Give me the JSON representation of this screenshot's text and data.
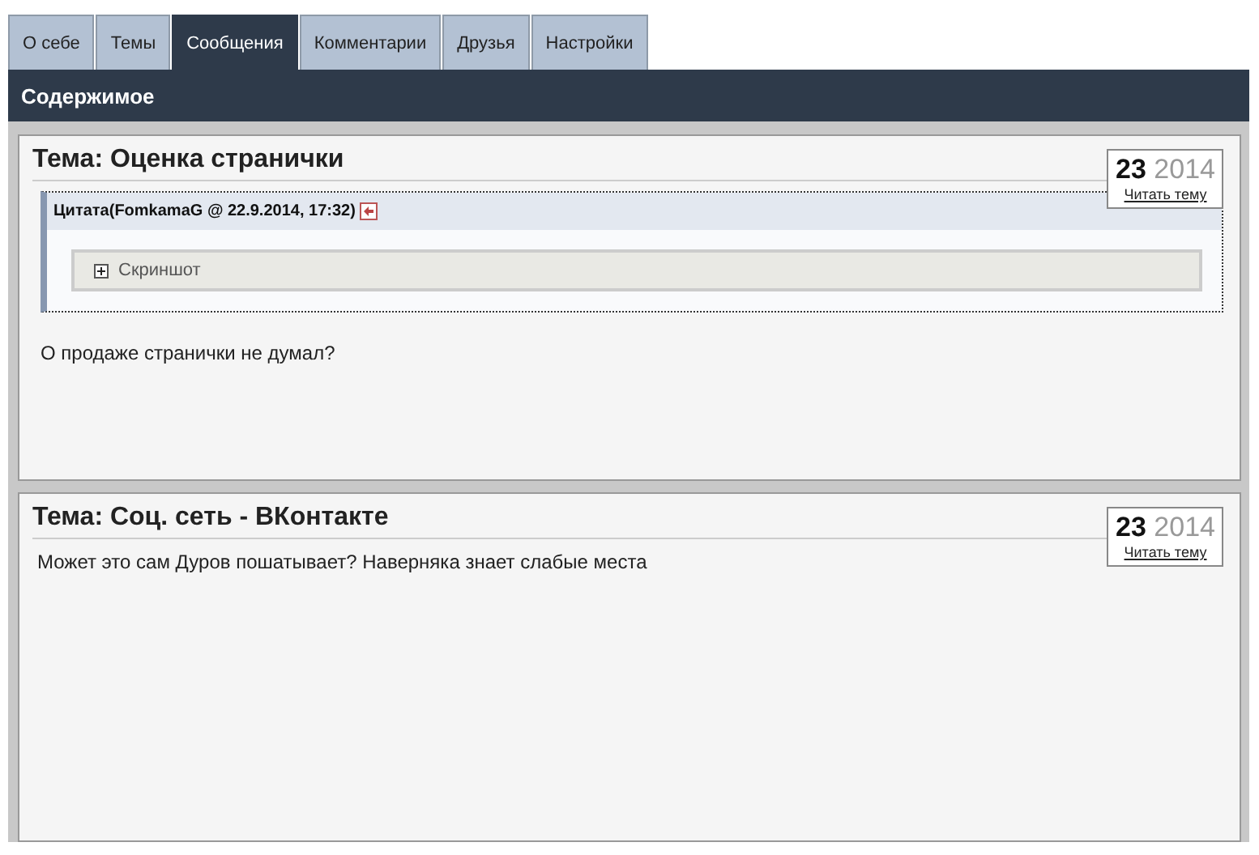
{
  "tabs": [
    {
      "label": "О себе",
      "selected": false
    },
    {
      "label": "Темы",
      "selected": false
    },
    {
      "label": "Сообщения",
      "selected": true
    },
    {
      "label": "Комментарии",
      "selected": false
    },
    {
      "label": "Друзья",
      "selected": false
    },
    {
      "label": "Настройки",
      "selected": false
    }
  ],
  "header": "Содержимое",
  "posts": [
    {
      "title": "Тема: Оценка странички",
      "day": "23",
      "year": "2014",
      "link": "Читать тему",
      "quote": {
        "header": "Цитата(FomkamaG @ 22.9.2014, 17:32)",
        "spoiler": "Скриншот"
      },
      "text": "О продаже странички не думал?"
    },
    {
      "title": "Тема: Соц. сеть - ВКонтакте",
      "day": "23",
      "year": "2014",
      "link": "Читать тему",
      "text": "Может это сам Дуров пошатывает? Наверняка знает слабые места"
    }
  ]
}
